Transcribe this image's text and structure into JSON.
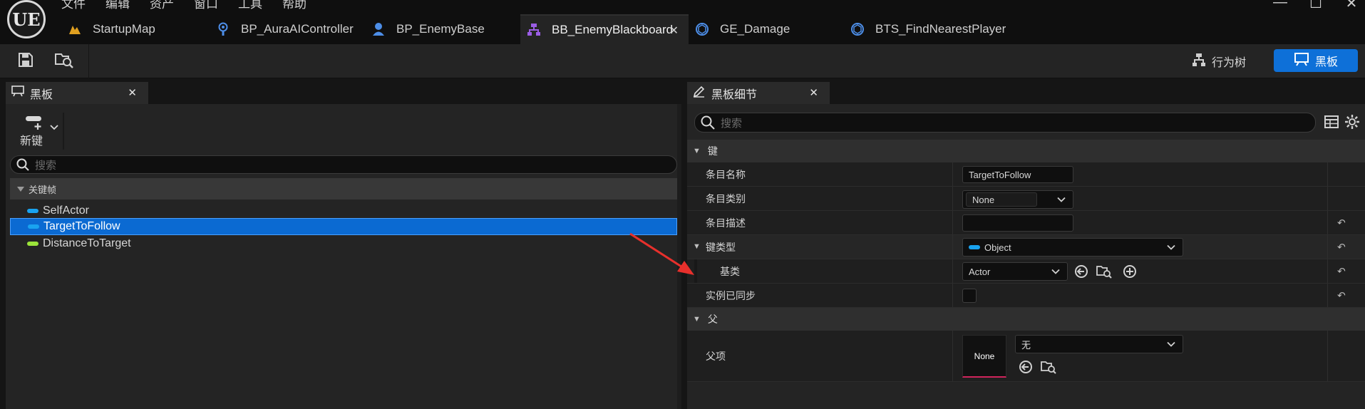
{
  "app": {
    "logo": "UE"
  },
  "menu": [
    "文件",
    "编辑",
    "资产",
    "窗口",
    "工具",
    "帮助"
  ],
  "window_controls": [
    "—",
    "☐",
    "✕"
  ],
  "tabs": [
    {
      "label": "StartupMap",
      "icon": "map-icon",
      "active": false
    },
    {
      "label": "BP_AuraAIController",
      "icon": "ai-controller-icon",
      "active": false
    },
    {
      "label": "BP_EnemyBase",
      "icon": "pawn-icon",
      "active": false
    },
    {
      "label": "BB_EnemyBlackboard",
      "icon": "blackboard-asset-icon",
      "active": true,
      "close": "✕"
    },
    {
      "label": "GE_Damage",
      "icon": "blueprint-icon",
      "active": false
    },
    {
      "label": "BTS_FindNearestPlayer",
      "icon": "blueprint-icon",
      "active": false
    }
  ],
  "toolbar": {
    "save_icon": "save-icon",
    "browse_icon": "browse-icon",
    "mode_behavior_tree": "行为树",
    "mode_blackboard": "黑板"
  },
  "left_panel": {
    "tab_label": "黑板",
    "tab_close": "✕",
    "new_key_label": "新键",
    "search_placeholder": "搜索",
    "section_label": "关键帧",
    "keys": [
      {
        "name": "SelfActor",
        "color": "#19a3f0",
        "selected": false
      },
      {
        "name": "TargetToFollow",
        "color": "#19a3f0",
        "selected": true
      },
      {
        "name": "DistanceToTarget",
        "color": "#9be43a",
        "selected": false
      }
    ]
  },
  "right_panel": {
    "tab_label": "黑板细节",
    "tab_close": "✕",
    "search_placeholder": "搜索",
    "section_key": "键",
    "entry_name_label": "条目名称",
    "entry_name_value": "TargetToFollow",
    "entry_category_label": "条目类别",
    "entry_category_value": "None",
    "entry_description_label": "条目描述",
    "entry_description_value": "",
    "key_type_label": "键类型",
    "key_type_value": "Object",
    "key_type_color": "#19a3f0",
    "base_class_label": "基类",
    "base_class_value": "Actor",
    "instance_synced_label": "实例已同步",
    "section_parent": "父",
    "parent_label": "父项",
    "parent_thumb": "None",
    "parent_value": "无",
    "reset_glyph": "↶"
  },
  "colors": {
    "accent_blue": "#0e70d8",
    "selection_blue": "#0b6ad2",
    "annotation_red": "#e8302c"
  }
}
